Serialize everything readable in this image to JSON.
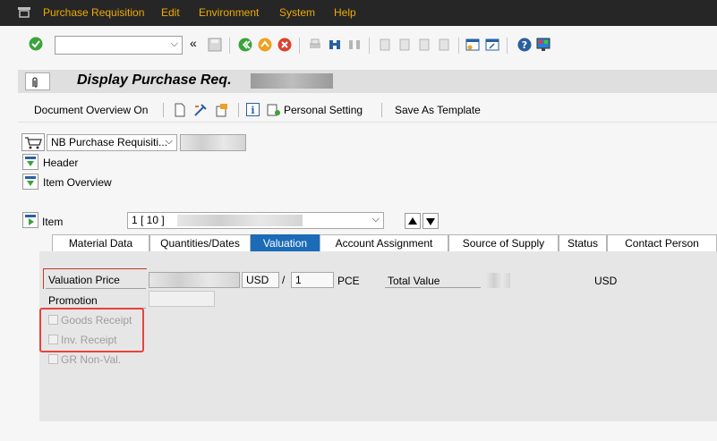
{
  "menu": {
    "items": [
      "Purchase Requisition",
      "Edit",
      "Environment",
      "System",
      "Help"
    ]
  },
  "toolbar": {
    "command_value": "",
    "nav_back_label": "«"
  },
  "title": {
    "text": "Display Purchase Req."
  },
  "app_toolbar": {
    "document_overview": "Document Overview On",
    "personal_setting": "Personal Setting",
    "save_template": "Save As Template"
  },
  "header": {
    "doc_type": "NB Purchase Requisiti...",
    "header_label": "Header",
    "item_overview_label": "Item Overview"
  },
  "item": {
    "label": "Item",
    "value": "1 [ 10 ]"
  },
  "tabs": [
    {
      "label": "Material Data",
      "active": false
    },
    {
      "label": "Quantities/Dates",
      "active": false
    },
    {
      "label": "Valuation",
      "active": true
    },
    {
      "label": "Account Assignment",
      "active": false
    },
    {
      "label": "Source of Supply",
      "active": false
    },
    {
      "label": "Status",
      "active": false
    },
    {
      "label": "Contact Person",
      "active": false
    }
  ],
  "valuation": {
    "price_label": "Valuation Price",
    "currency": "USD",
    "slash": "/",
    "per_qty": "1",
    "unit": "PCE",
    "total_label": "Total Value",
    "total_currency": "USD",
    "promotion_label": "Promotion",
    "goods_receipt": "Goods Receipt",
    "inv_receipt": "Inv. Receipt",
    "gr_nonval": "GR Non-Val."
  },
  "colors": {
    "menu_bg": "#262626",
    "menu_text": "#f0ab00",
    "active_tab": "#1c6bb8",
    "highlight_box": "#e8413c"
  }
}
